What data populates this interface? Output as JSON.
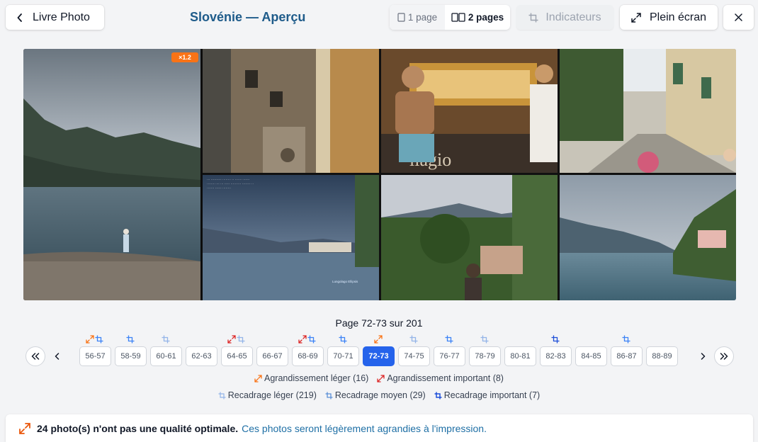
{
  "header": {
    "back_label": "Livre Photo",
    "title": "Slovénie — Aperçu",
    "view_single_label": "1 page",
    "view_double_label": "2 pages",
    "indicators_label": "Indicateurs",
    "fullscreen_label": "Plein écran"
  },
  "spread": {
    "scale_badge": "×1.2",
    "screen_caption": "Lungolago Ellipsis"
  },
  "pagination": {
    "info": "Page 72-73 sur 201",
    "current": "72-73",
    "pages": [
      {
        "label": "56-57",
        "icons": [
          "upscale-orange",
          "crop-blue"
        ]
      },
      {
        "label": "58-59",
        "icons": [
          "crop-blue"
        ]
      },
      {
        "label": "60-61",
        "icons": [
          "crop-light"
        ]
      },
      {
        "label": "62-63",
        "icons": []
      },
      {
        "label": "64-65",
        "icons": [
          "upscale-red",
          "crop-light"
        ]
      },
      {
        "label": "66-67",
        "icons": []
      },
      {
        "label": "68-69",
        "icons": [
          "upscale-red",
          "crop-blue"
        ]
      },
      {
        "label": "70-71",
        "icons": [
          "crop-blue"
        ]
      },
      {
        "label": "72-73",
        "icons": [
          "upscale-orange"
        ]
      },
      {
        "label": "74-75",
        "icons": [
          "crop-light"
        ]
      },
      {
        "label": "76-77",
        "icons": [
          "crop-blue"
        ]
      },
      {
        "label": "78-79",
        "icons": [
          "crop-light"
        ]
      },
      {
        "label": "80-81",
        "icons": []
      },
      {
        "label": "82-83",
        "icons": [
          "crop-dark"
        ]
      },
      {
        "label": "84-85",
        "icons": []
      },
      {
        "label": "86-87",
        "icons": [
          "crop-blue"
        ]
      },
      {
        "label": "88-89",
        "icons": []
      }
    ]
  },
  "legend": {
    "upscale_light": "Agrandissement léger (16)",
    "upscale_strong": "Agrandissement important (8)",
    "crop_light": "Recadrage léger (219)",
    "crop_medium": "Recadrage moyen (29)",
    "crop_strong": "Recadrage important (7)"
  },
  "banner": {
    "count_text": "24 photo(s) n'ont pas une qualité optimale.",
    "info_text": "Ces photos seront légèrement agrandies à l'impression."
  },
  "colors": {
    "accent": "#2563eb",
    "title": "#1e5b8a",
    "warning_orange": "#f97316",
    "warning_red": "#dc2626"
  }
}
